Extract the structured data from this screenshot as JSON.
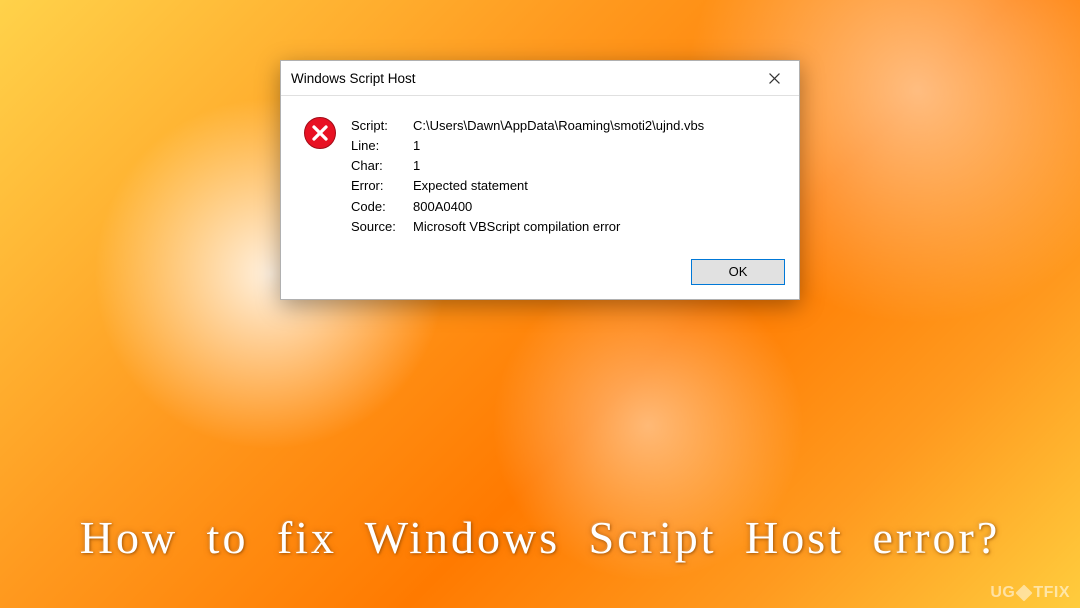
{
  "dialog": {
    "title": "Windows Script Host",
    "close_glyph": "✕",
    "fields": {
      "script_label": "Script:",
      "script_value": "C:\\Users\\Dawn\\AppData\\Roaming\\smoti2\\ujnd.vbs",
      "line_label": "Line:",
      "line_value": "1",
      "char_label": "Char:",
      "char_value": "1",
      "error_label": "Error:",
      "error_value": "Expected statement",
      "code_label": "Code:",
      "code_value": "800A0400",
      "source_label": "Source:",
      "source_value": "Microsoft VBScript compilation error"
    },
    "ok_label": "OK"
  },
  "caption": "How to fix Windows Script Host error?",
  "watermark": {
    "left": "UG",
    "right": "TFIX"
  }
}
